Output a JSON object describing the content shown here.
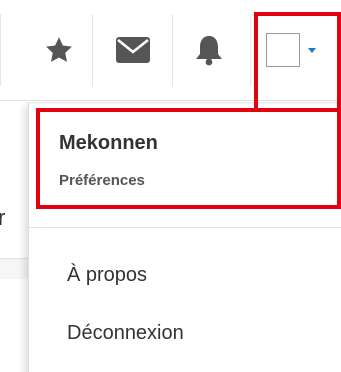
{
  "navbar": {
    "icons": [
      "star-icon",
      "envelope-icon",
      "bell-icon"
    ],
    "caret_color": "#1b78c6"
  },
  "background": {
    "partial_char": "r"
  },
  "dropdown": {
    "user_name": "Mekonnen",
    "preferences_label": "Préférences",
    "items": [
      {
        "label": "À propos"
      },
      {
        "label": "Déconnexion"
      }
    ]
  },
  "highlight_color": "#e3000f"
}
